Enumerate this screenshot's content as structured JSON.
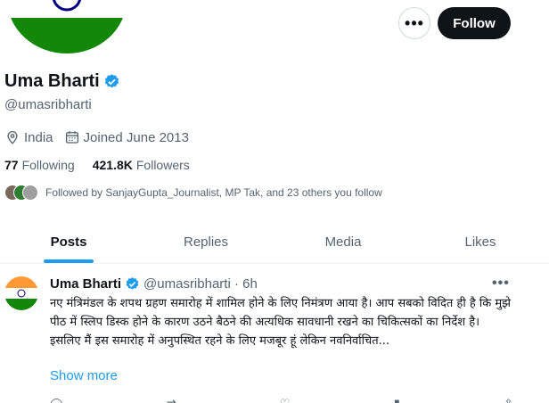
{
  "profile": {
    "name": "Uma Bharti",
    "handle": "@umasribharti",
    "location": "India",
    "joined": "Joined June 2013",
    "following_count": "77",
    "following_label": "Following",
    "followers_count": "421.8K",
    "followers_label": "Followers",
    "followed_by": "Followed by SanjayGupta_Journalist, MP Tak, and 23 others you follow"
  },
  "header": {
    "more_label": "•••",
    "follow_label": "Follow"
  },
  "tabs": [
    {
      "label": "Posts",
      "active": true
    },
    {
      "label": "Replies",
      "active": false
    },
    {
      "label": "Media",
      "active": false
    },
    {
      "label": "Likes",
      "active": false
    }
  ],
  "tweet": {
    "name": "Uma Bharti",
    "handle_time": "@umasribharti · 6h",
    "text": "नए मंत्रिमंडल के शपथ ग्रहण समारोह में शामिल होने के लिए निमंत्रण आया है। आप सबको विदित ही है कि मुझे पीठ में स्लिप डिस्क होने के कारण उठने बैठने की अत्यधिक सावधानी रखने का चिकित्सकों का निर्देश है। इसलिए मैं इस समारोह में अनुपस्थित रहने के लिए मजबूर हूं लेकिन नवनिर्वाचित...",
    "show_more": "Show more",
    "more_label": "•••"
  },
  "colors": {
    "accent": "#1d9bf0",
    "saffron": "#ff9933",
    "india_green": "#138808"
  }
}
